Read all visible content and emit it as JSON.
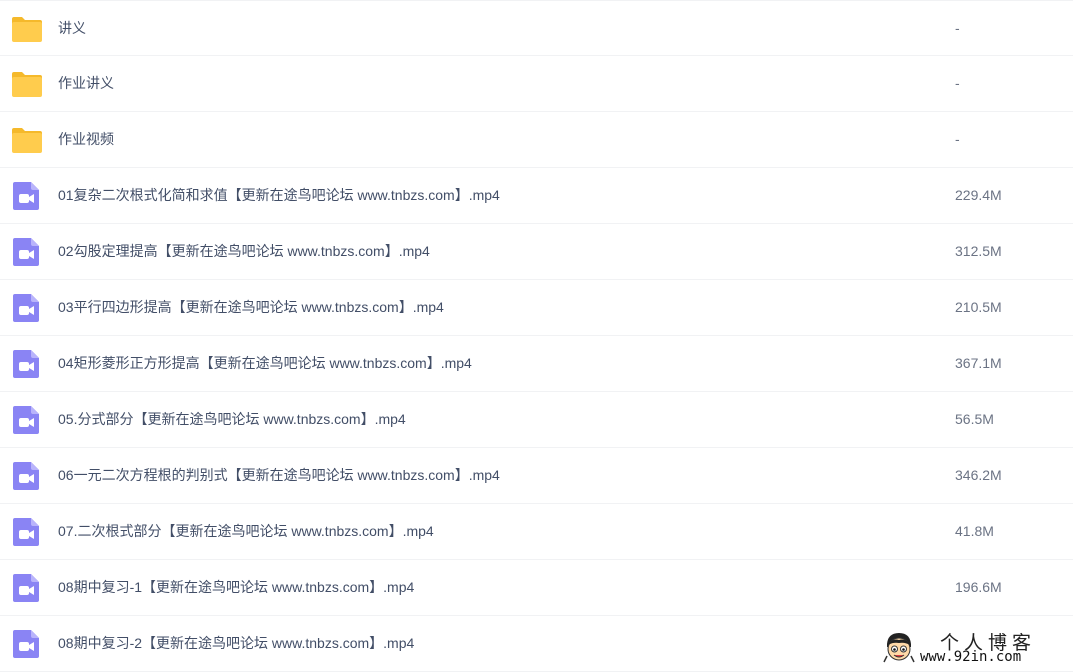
{
  "colors": {
    "folder": "#ffcc4d",
    "folder_dark": "#f5b92b",
    "video": "#8a84f4",
    "text": "#424e67",
    "divider": "#f1f2f4"
  },
  "files": [
    {
      "name": "讲义",
      "size": "-",
      "icon": "folder-icon"
    },
    {
      "name": "作业讲义",
      "size": "-",
      "icon": "folder-icon"
    },
    {
      "name": "作业视频",
      "size": "-",
      "icon": "folder-icon"
    },
    {
      "name": "01复杂二次根式化简和求值【更新在途鸟吧论坛 www.tnbzs.com】.mp4",
      "size": "229.4M",
      "icon": "video-file-icon"
    },
    {
      "name": "02勾股定理提高【更新在途鸟吧论坛 www.tnbzs.com】.mp4",
      "size": "312.5M",
      "icon": "video-file-icon"
    },
    {
      "name": "03平行四边形提高【更新在途鸟吧论坛 www.tnbzs.com】.mp4",
      "size": "210.5M",
      "icon": "video-file-icon"
    },
    {
      "name": "04矩形菱形正方形提高【更新在途鸟吧论坛 www.tnbzs.com】.mp4",
      "size": "367.1M",
      "icon": "video-file-icon"
    },
    {
      "name": "05.分式部分【更新在途鸟吧论坛 www.tnbzs.com】.mp4",
      "size": "56.5M",
      "icon": "video-file-icon"
    },
    {
      "name": "06一元二次方程根的判别式【更新在途鸟吧论坛 www.tnbzs.com】.mp4",
      "size": "346.2M",
      "icon": "video-file-icon"
    },
    {
      "name": "07.二次根式部分【更新在途鸟吧论坛 www.tnbzs.com】.mp4",
      "size": "41.8M",
      "icon": "video-file-icon"
    },
    {
      "name": "08期中复习-1【更新在途鸟吧论坛 www.tnbzs.com】.mp4",
      "size": "196.6M",
      "icon": "video-file-icon"
    },
    {
      "name": "08期中复习-2【更新在途鸟吧论坛 www.tnbzs.com】.mp4",
      "size": "",
      "icon": "video-file-icon"
    }
  ],
  "watermark": {
    "title": "个人博客",
    "url": "www.92in.com",
    "icon": "cartoon-face-icon"
  }
}
